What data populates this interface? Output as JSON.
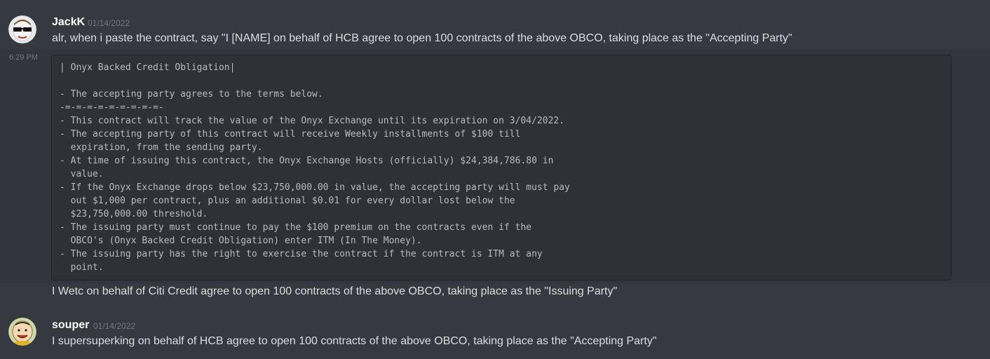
{
  "messages": [
    {
      "username": "JackK",
      "date": "01/14/2022",
      "text": "alr, when i paste the contract, say \"I [NAME] on behalf of HCB agree to open 100 contracts of the above OBCO, taking place as the \"Accepting Party\""
    },
    {
      "side_time": "6:29 PM",
      "code_lines": [
        "| Onyx Backed Credit Obligation|",
        "",
        "- The accepting party agrees to the terms below.",
        "-=-=-=-=-=-=-=-=-=-",
        "- This contract will track the value of the Onyx Exchange until its expiration on 3/04/2022.",
        "- The accepting party of this contract will receive Weekly installments of $100 till",
        "  expiration, from the sending party.",
        "- At time of issuing this contract, the Onyx Exchange Hosts (officially) $24,384,786.80 in",
        "  value.",
        "- If the Onyx Exchange drops below $23,750,000.00 in value, the accepting party will must pay",
        "  out $1,000 per contract, plus an additional $0.01 for every dollar lost below the",
        "  $23,750,000.00 threshold.",
        "- The issuing party must continue to pay the $100 premium on the contracts even if the",
        "  OBCO's (Onyx Backed Credit Obligation) enter ITM (In The Money).",
        "- The issuing party has the right to exercise the contract if the contract is ITM at any",
        "  point."
      ]
    },
    {
      "text": "I Wetc on behalf of Citi Credit agree to open 100 contracts of the above OBCO, taking place as the \"Issuing Party\""
    },
    {
      "username": "souper",
      "date": "01/14/2022",
      "text": "I supersuperking on behalf of HCB agree to open 100 contracts of the above OBCO, taking place as the \"Accepting Party\""
    }
  ],
  "colors": {
    "background": "#36393f",
    "hover_background": "#32353b",
    "code_background": "#2f3136",
    "username": "#ffffff",
    "text": "#dcddde",
    "muted": "#72767d"
  },
  "icons": [
    "jackk-avatar-icon",
    "souper-avatar-icon"
  ]
}
